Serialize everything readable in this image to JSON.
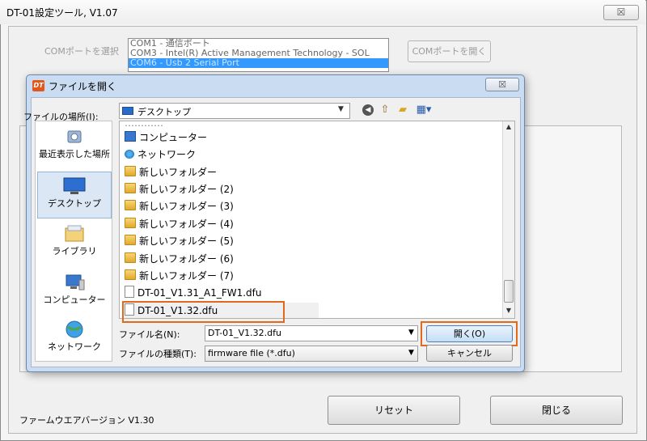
{
  "main": {
    "title": "DT-01設定ツール, V1.07",
    "close_glyph": "☒",
    "com_label": "COMポートを選択",
    "com_ports": [
      "COM1  -  通信ポート",
      "COM3  -  Intel(R) Active Management Technology - SOL",
      "COM6  -  Usb 2 Serial Port"
    ],
    "com_open_label": "COMポートを開く",
    "firmware_label": "ファームウエアバージョン V1.30",
    "reset_label": "リセット",
    "close_label": "閉じる"
  },
  "dialog": {
    "icon_text": "DT",
    "title": "ファイルを開く",
    "close_glyph": "☒",
    "lookin_label": "ファイルの場所(I):",
    "lookin_value": "デスクトップ",
    "places": [
      {
        "label": "最近表示した場所",
        "icon": "recent-places-icon"
      },
      {
        "label": "デスクトップ",
        "icon": "desktop-icon",
        "selected": true
      },
      {
        "label": "ライブラリ",
        "icon": "library-icon"
      },
      {
        "label": "コンピューター",
        "icon": "computer-icon"
      },
      {
        "label": "ネットワーク",
        "icon": "network-icon"
      }
    ],
    "files": [
      {
        "name": "コンピューター",
        "type": "computer"
      },
      {
        "name": "ネットワーク",
        "type": "network"
      },
      {
        "name": "新しいフォルダー",
        "type": "folder"
      },
      {
        "name": "新しいフォルダー (2)",
        "type": "folder"
      },
      {
        "name": "新しいフォルダー (3)",
        "type": "folder"
      },
      {
        "name": "新しいフォルダー (4)",
        "type": "folder"
      },
      {
        "name": "新しいフォルダー (5)",
        "type": "folder"
      },
      {
        "name": "新しいフォルダー (6)",
        "type": "folder"
      },
      {
        "name": "新しいフォルダー (7)",
        "type": "folder"
      },
      {
        "name": "DT-01_V1.31_A1_FW1.dfu",
        "type": "file"
      },
      {
        "name": "DT-01_V1.32.dfu",
        "type": "file",
        "selected": true
      }
    ],
    "filename_label": "ファイル名(N):",
    "filename_value": "DT-01_V1.32.dfu",
    "filetype_label": "ファイルの種類(T):",
    "filetype_value": "firmware file (*.dfu)",
    "open_label": "開く(O)",
    "cancel_label": "キャンセル"
  },
  "colors": {
    "highlight_outline": "#e06a1c",
    "selection_blue": "#3399ff",
    "dialog_frame": "#c9dcf2"
  }
}
